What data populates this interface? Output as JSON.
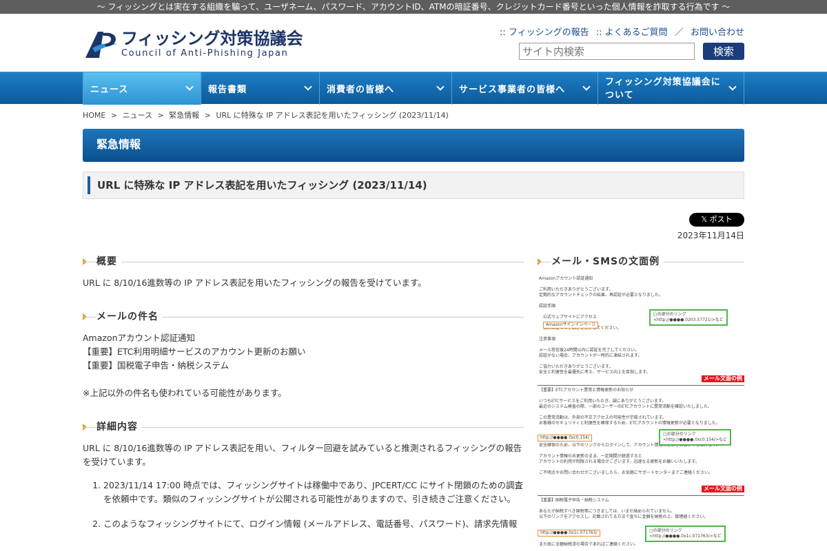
{
  "topbar": {
    "text": "〜 フィッシングとは実在する組織を騙って、ユーザネーム、パスワード、アカウントID、ATMの暗証番号、クレジットカード番号といった個人情報を詐取する行為です 〜"
  },
  "header": {
    "logo_jp": "フィッシング対策協議会",
    "logo_en": "Council of Anti-Phishing Japan",
    "links": [
      ":: フィッシングの報告",
      ":: よくあるご質問",
      "／",
      "お問い合わせ"
    ],
    "search_placeholder": "サイト内検索",
    "search_button": "検索"
  },
  "gnav": [
    {
      "label": "ニュース",
      "width": 172
    },
    {
      "label": "報告書類",
      "width": 172
    },
    {
      "label": "消費者の皆様へ",
      "width": 192
    },
    {
      "label": "サービス事業者の皆様へ",
      "width": 212
    },
    {
      "label": "フィッシング対策協議会について",
      "width": 212
    }
  ],
  "breadcrumb": [
    "HOME",
    ">",
    "ニュース",
    ">",
    "緊急情報",
    ">",
    "URL に特殊な IP アドレス表記を用いたフィッシング (2023/11/14)"
  ],
  "section_title": "緊急情報",
  "page_title": "URL に特殊な IP アドレス表記を用いたフィッシング (2023/11/14)",
  "share": {
    "xpost": "𝕏 ポスト",
    "date": "2023年11月14日"
  },
  "main": {
    "overview_h": "概要",
    "overview": "URL に 8/10/16進数等の IP アドレス表記を用いたフィッシングの報告を受けています。",
    "subject_h": "メールの件名",
    "subjects": [
      "Amazonアカウント認証通知",
      "【重要】ETC利用明細サービスのアカウント更新のお願い",
      "【重要】国税電子申告・納税システム"
    ],
    "subject_note": "※上記以外の件名も使われている可能性があります。",
    "detail_h": "詳細内容",
    "detail": "URL に 8/10/16進数等の IP アドレス表記を用い、フィルター回避を試みていると推測されるフィッシングの報告を受けています。",
    "list": [
      "2023/11/14 17:00 時点では、フィッシングサイトは稼働中であり、JPCERT/CC にサイト閉鎖のための調査を依頼中です。類似のフィッシングサイトが公開される可能性がありますので、引き続きご注意ください。",
      "このようなフィッシングサイトにて、ログイン情報 (メールアドレス、電話番号、パスワード)、請求先情報"
    ]
  },
  "side": {
    "h": "メール・SMSの文面例",
    "tag": "メール文面の例",
    "m1": [
      "Amazonアカウント認証通知",
      "",
      "ご利用いただきありがとうございます。",
      "定期的なアカウントチェックの結果、再認証が必要となりました。",
      "",
      "認証手順",
      "",
      "　公式ウェブサイトにアクセス",
      "",
      "　指示に従って手続きを完了してください。",
      "",
      "注意事項",
      "",
      "メール受信後24時間以内に認証を完了してください。",
      "認証がない場合、アカウントが一時的に凍結されます。",
      "",
      "ご協力いただきありがとうございます。",
      "安全と利便性を最優先に考え、サービス向上を目指します。"
    ],
    "m1_orange": "Amazonサインインページ",
    "m1_green": [
      "□の部分のリンク",
      "<http://●●●●.0203.57721/>など"
    ],
    "m2": [
      "【重要】ETCアカウント異常と情報更新のお知らせ",
      "",
      "いつもETCサービスをご利用いただき、誠にありがとうございます。",
      "最近のシステム検査の際、一部のユーザーのETCアカウントに異常活動を確認いたしました。",
      "",
      "この異常活動は、外部の不正アクセスの可能性が示唆されています。",
      "お客様のセキュリティと利便性を確保するため、ETCアカウントの情報更新が必要となりました。",
      "",
      "",
      "",
      "安全確保のため、以下のリンクからログインして、アカウント情報の更新をお願い申し上げます。",
      "",
      "アカウント情報の未更新のまま、一定期間が経過すると",
      "アカウントの利用が制限される場合がございます。迅速なる更新をお願いいたします。",
      "",
      "ご不明点やお問い合わせがございましたら、お気軽にサポートセンターまでご連絡ください。"
    ],
    "m2_orange": "http://●●●●.0xc0.154/",
    "m2_green": [
      "□の部分のリンク",
      "<http://●●●●.0xc0.154/>など"
    ],
    "m3": [
      "【重要】国税電子申告・納税システム",
      "",
      "あなたが納税すべき国税等につきましては、いまだ納められていません。",
      "以下のリンクをアクセスし、記載されてる方法で直ちに金額を納税の上、御連絡ください。",
      "",
      "",
      "",
      "",
      "また既に全額納税済の場合であればご連絡ください。"
    ],
    "m3_orange": "http://●●●●.0x1c.071763/",
    "m3_green": [
      "□の部分のリンク",
      "<http://●●●●.0x1c.071763/>など"
    ]
  }
}
